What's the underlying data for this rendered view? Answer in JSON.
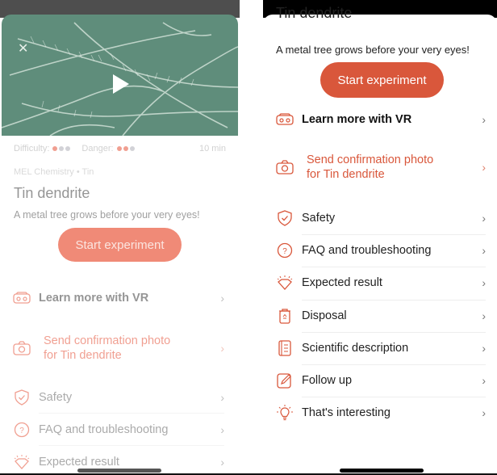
{
  "colors": {
    "accent": "#d9573b",
    "accent_faded": "#f08a77",
    "dot_active": "#e8664f",
    "dot_inactive": "#b8b8c0",
    "icon_stroke": "#d9573b"
  },
  "left_screen": {
    "close_icon": "close-icon",
    "play_icon": "play-icon",
    "difficulty_label": "Difficulty:",
    "difficulty_level": 1,
    "difficulty_max": 3,
    "danger_label": "Danger:",
    "danger_level": 2,
    "danger_max": 3,
    "duration": "10 min",
    "breadcrumb": "MEL Chemistry • Tin",
    "title": "Tin dendrite",
    "subtitle": "A metal tree grows before your very eyes!",
    "start_button": "Start experiment",
    "items": [
      {
        "label": "Learn more with VR",
        "icon": "vr-headset-icon"
      },
      {
        "label": "Send confirmation photo",
        "label_line2": "for Tin dendrite",
        "icon": "camera-icon"
      },
      {
        "label": "Safety",
        "icon": "shield-check-icon"
      },
      {
        "label": "FAQ and troubleshooting",
        "icon": "question-circle-icon"
      },
      {
        "label": "Expected result",
        "icon": "diamond-icon"
      }
    ]
  },
  "right_screen": {
    "clipped_title": "Tin dendrite",
    "subtitle": "A metal tree grows before your very eyes!",
    "start_button": "Start experiment",
    "items": [
      {
        "label": "Learn more with VR",
        "icon": "vr-headset-icon"
      },
      {
        "label": "Send confirmation photo",
        "label_line2": "for Tin dendrite",
        "icon": "camera-icon"
      },
      {
        "label": "Safety",
        "icon": "shield-check-icon"
      },
      {
        "label": "FAQ and troubleshooting",
        "icon": "question-circle-icon"
      },
      {
        "label": "Expected result",
        "icon": "diamond-icon"
      },
      {
        "label": "Disposal",
        "icon": "recycle-bin-icon"
      },
      {
        "label": "Scientific description",
        "icon": "document-icon"
      },
      {
        "label": "Follow up",
        "icon": "edit-icon"
      },
      {
        "label": "That's interesting",
        "icon": "lightbulb-icon"
      }
    ]
  },
  "chevron": "›"
}
